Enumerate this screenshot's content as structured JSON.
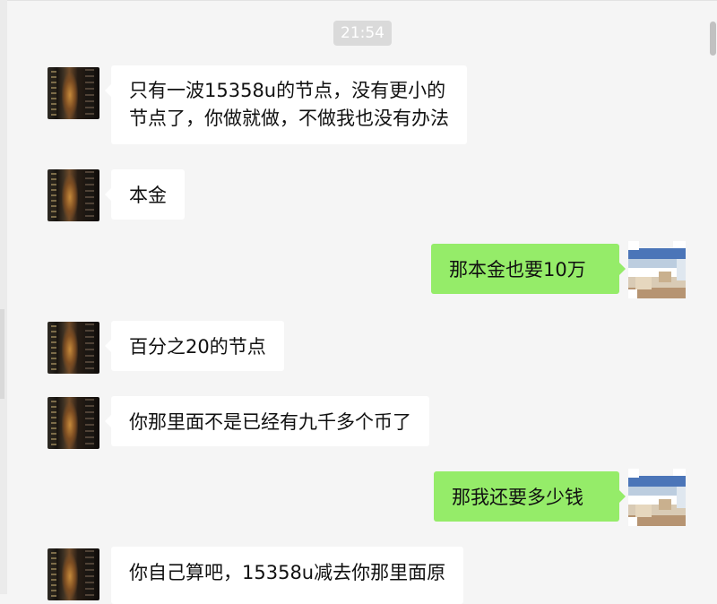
{
  "chat": {
    "timestamp": "21:54",
    "messages": [
      {
        "side": "left",
        "lines": [
          "只有一波15358u的节点，没有更小的",
          "节点了，你做就做，不做我也没有办法"
        ]
      },
      {
        "side": "left",
        "lines": [
          "本金"
        ]
      },
      {
        "side": "right",
        "lines": [
          "那本金也要10万"
        ]
      },
      {
        "side": "left",
        "lines": [
          "百分之20的节点"
        ]
      },
      {
        "side": "left",
        "lines": [
          "你那里面不是已经有九千多个币了"
        ]
      },
      {
        "side": "right",
        "lines": [
          "那我还要多少钱"
        ]
      },
      {
        "side": "left",
        "lines": [
          "你自己算吧，15358u减去你那里面原"
        ]
      }
    ]
  }
}
